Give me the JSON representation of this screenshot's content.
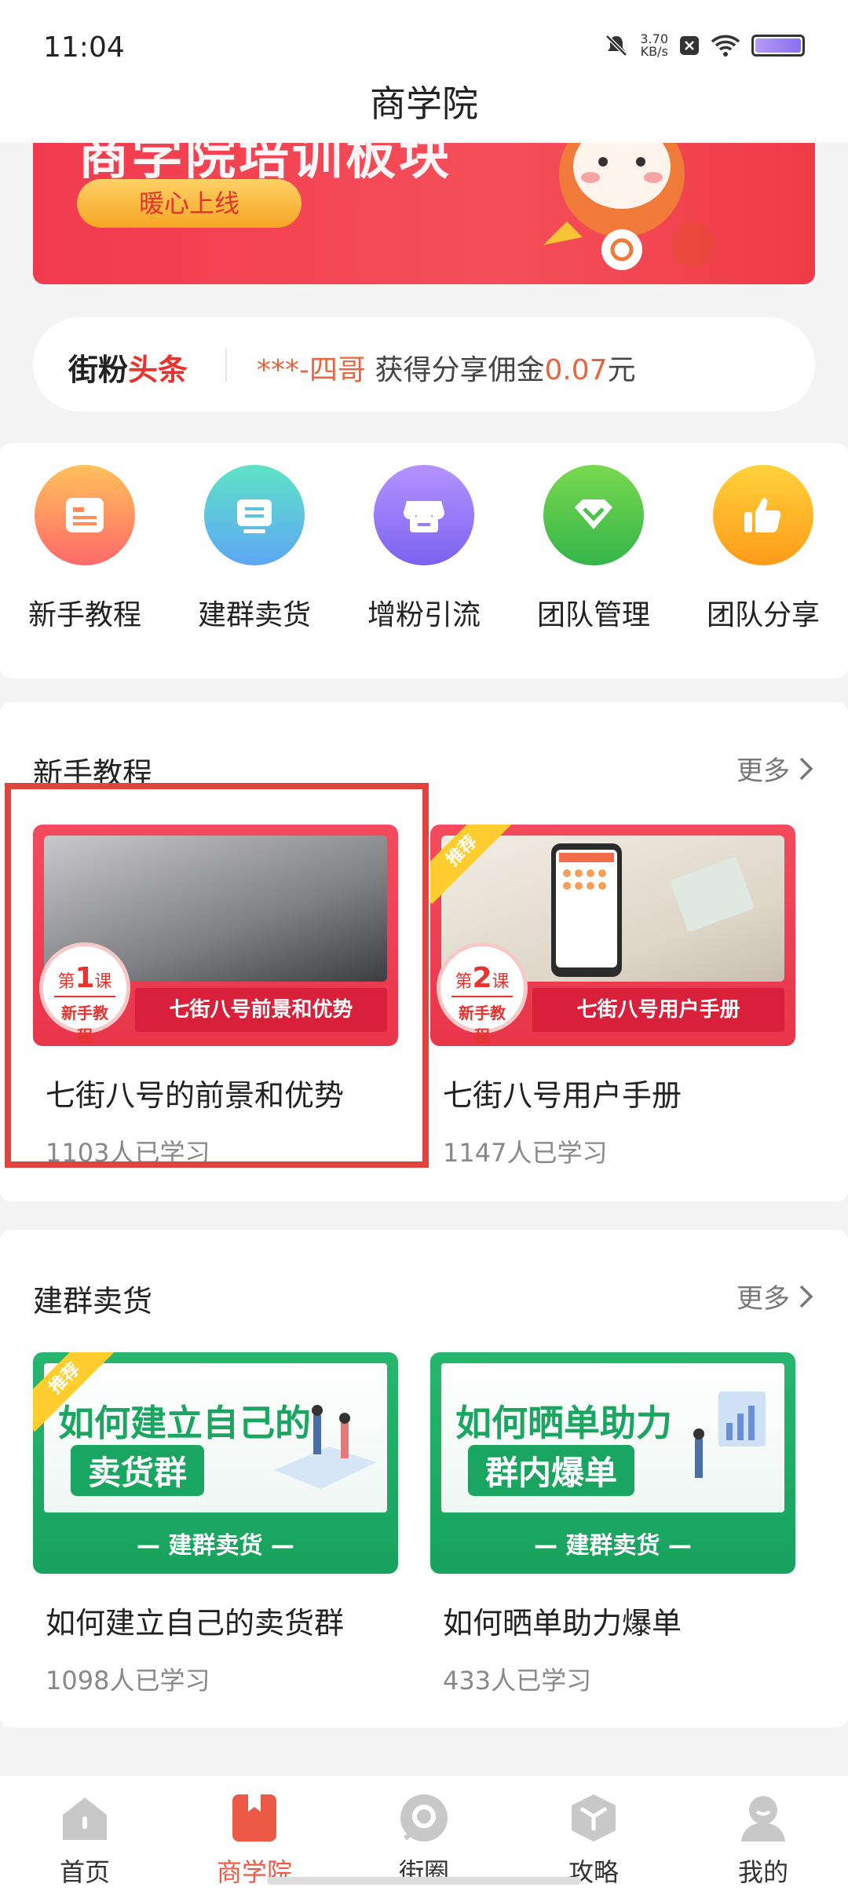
{
  "status_bar": {
    "time": "11:04",
    "net_speed_value": "3.70",
    "net_speed_unit": "KB/s"
  },
  "header": {
    "title": "商学院"
  },
  "banner": {
    "title": "商学院培训板块",
    "pill_label": "暖心上线"
  },
  "headline": {
    "brand_a": "街粉",
    "brand_b": "头条",
    "user": "***-四哥",
    "text_mid": " 获得分享佣金",
    "amount": "0.07",
    "unit": "元"
  },
  "categories": [
    {
      "label": "新手教程",
      "icon": "document-icon",
      "color_from": "#ffc15a",
      "color_to": "#ff6a6a"
    },
    {
      "label": "建群卖货",
      "icon": "card-icon",
      "color_from": "#5fe3c6",
      "color_to": "#5da7f5"
    },
    {
      "label": "增粉引流",
      "icon": "store-icon",
      "color_from": "#b593ff",
      "color_to": "#7b63f0"
    },
    {
      "label": "团队管理",
      "icon": "diamond-icon",
      "color_from": "#79d94f",
      "color_to": "#34b54a"
    },
    {
      "label": "团队分享",
      "icon": "thumbs-up-icon",
      "color_from": "#ffd23a",
      "color_to": "#ff9b1a"
    }
  ],
  "section_newbie": {
    "title": "新手教程",
    "more": "更多",
    "cards": [
      {
        "title": "七街八号的前景和优势",
        "count": "1103人已学习",
        "badge_top_a": "第",
        "badge_num": "1",
        "badge_top_b": "课",
        "badge_bottom": "新手教程",
        "band": "七街八号前景和优势"
      },
      {
        "title": "七街八号用户手册",
        "count": "1147人已学习",
        "ribbon": "推荐",
        "badge_top_a": "第",
        "badge_num": "2",
        "badge_top_b": "课",
        "badge_bottom": "新手教程",
        "band": "七街八号用户手册"
      }
    ]
  },
  "section_group": {
    "title": "建群卖货",
    "more": "更多",
    "cards": [
      {
        "title": "如何建立自己的卖货群",
        "count": "1098人已学习",
        "ribbon": "推荐",
        "line1": "如何建立自己的",
        "line2": "卖货群",
        "band": "— 建群卖货 —"
      },
      {
        "title": "如何晒单助力爆单",
        "count": "433人已学习",
        "line1": "如何晒单助力",
        "line2": "群内爆单",
        "band": "— 建群卖货 —"
      }
    ]
  },
  "bottom_nav": [
    {
      "label": "首页",
      "icon": "home-icon"
    },
    {
      "label": "商学院",
      "icon": "book-icon",
      "active": true
    },
    {
      "label": "街圈",
      "icon": "circle-icon"
    },
    {
      "label": "攻略",
      "icon": "cube-icon"
    },
    {
      "label": "我的",
      "icon": "user-icon"
    }
  ]
}
